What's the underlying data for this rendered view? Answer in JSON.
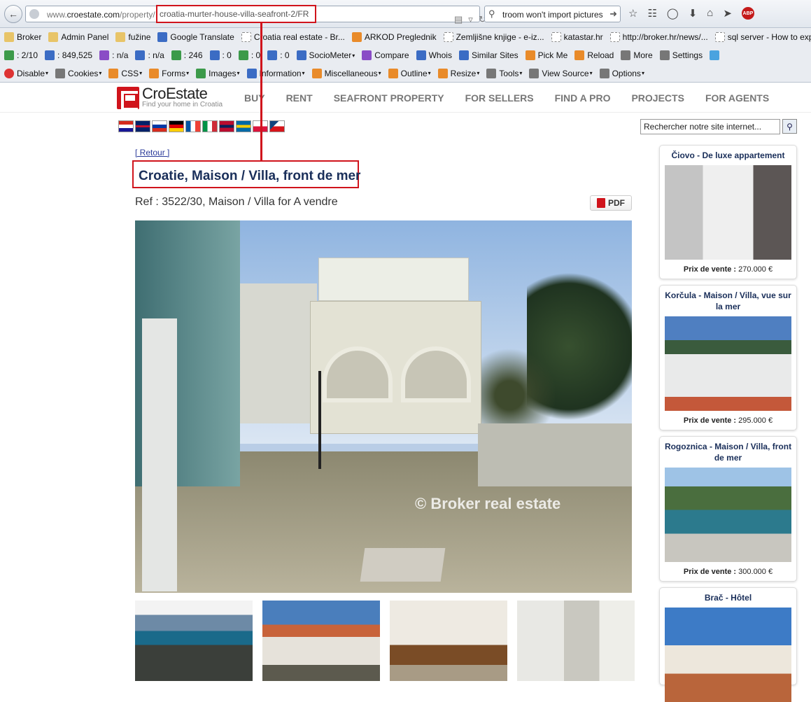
{
  "browser": {
    "url_prefix": "www.",
    "url_host": "croestate.com",
    "url_path": "/property/",
    "url_highlight": "croatia-murter-house-villa-seafront-2/FR",
    "search_text": "troom won't import pictures"
  },
  "bookmarks_row1": [
    {
      "label": "Broker",
      "icon": "folder-icon"
    },
    {
      "label": "Admin Panel",
      "icon": "folder-icon"
    },
    {
      "label": "fužine",
      "icon": "folder-icon"
    },
    {
      "label": "Google Translate",
      "icon": "translate-icon"
    },
    {
      "label": "Croatia real estate - Br...",
      "icon": "page-icon"
    },
    {
      "label": "ARKOD Preglednik",
      "icon": "gear-icon"
    },
    {
      "label": "Zemljišne knjige - e-iz...",
      "icon": "page-icon"
    },
    {
      "label": "katastar.hr",
      "icon": "page-icon"
    },
    {
      "label": "http://broker.hr/news/...",
      "icon": "page-icon"
    },
    {
      "label": "sql server - How to exp...",
      "icon": "page-icon"
    }
  ],
  "bookmarks_row2": [
    {
      "label": ": 2/10",
      "icon": "google-icon"
    },
    {
      "label": ": 849,525",
      "icon": "alexa-icon"
    },
    {
      "label": ": n/a",
      "icon": "stats-icon"
    },
    {
      "label": ": n/a",
      "icon": "alpha-icon"
    },
    {
      "label": ": 246",
      "icon": "google-icon"
    },
    {
      "label": ": 0",
      "icon": "bing-icon"
    },
    {
      "label": ": 0",
      "icon": "google-icon"
    },
    {
      "label": ": 0",
      "icon": "bing-icon"
    },
    {
      "label": "SocioMeter",
      "icon": "chart-icon",
      "caret": true
    },
    {
      "label": "Compare",
      "icon": "compare-icon"
    },
    {
      "label": "Whois",
      "icon": "help-icon"
    },
    {
      "label": "Similar Sites",
      "icon": "similar-icon"
    },
    {
      "label": "Pick Me",
      "icon": "pick-icon"
    },
    {
      "label": "Reload",
      "icon": "reload-icon"
    },
    {
      "label": "More",
      "icon": "more-icon"
    },
    {
      "label": "Settings",
      "icon": "settings-icon"
    },
    {
      "label": "",
      "icon": "twitter-icon"
    }
  ],
  "bookmarks_row3": [
    {
      "label": "Disable",
      "icon": "disable-icon",
      "caret": true
    },
    {
      "label": "Cookies",
      "icon": "cookie-icon",
      "caret": true
    },
    {
      "label": "CSS",
      "icon": "css-icon",
      "caret": true
    },
    {
      "label": "Forms",
      "icon": "forms-icon",
      "caret": true
    },
    {
      "label": "Images",
      "icon": "images-icon",
      "caret": true
    },
    {
      "label": "Information",
      "icon": "info-icon",
      "caret": true
    },
    {
      "label": "Miscellaneous",
      "icon": "misc-icon",
      "caret": true
    },
    {
      "label": "Outline",
      "icon": "outline-icon",
      "caret": true
    },
    {
      "label": "Resize",
      "icon": "resize-icon",
      "caret": true
    },
    {
      "label": "Tools",
      "icon": "tools-icon",
      "caret": true
    },
    {
      "label": "View Source",
      "icon": "source-icon",
      "caret": true
    },
    {
      "label": "Options",
      "icon": "options-icon",
      "caret": true
    }
  ],
  "site": {
    "logo_name": "CroEstate",
    "logo_tagline": "Find your home in Croatia",
    "nav": [
      "BUY",
      "RENT",
      "SEAFRONT PROPERTY",
      "FOR SELLERS",
      "FIND A PRO",
      "PROJECTS",
      "FOR AGENTS"
    ],
    "search_placeholder": "Rechercher notre site internet...",
    "flags": [
      "croatian-flag",
      "uk-flag",
      "russian-flag",
      "german-flag",
      "french-flag",
      "italian-flag",
      "norwegian-flag",
      "swedish-flag",
      "polish-flag",
      "czech-flag"
    ]
  },
  "property": {
    "back_link": "[ Retour ]",
    "title": "Croatie, Maison / Villa, front de mer",
    "ref": "Ref : 3522/30, Maison / Villa for A vendre",
    "pdf_label": "PDF",
    "watermark": "© Broker real estate"
  },
  "sidebar": [
    {
      "title": "Čiovo - De luxe appartement",
      "price_label": "Prix de vente :",
      "price": "270.000 €"
    },
    {
      "title": "Korčula - Maison / Villa, vue sur la mer",
      "price_label": "Prix de vente :",
      "price": "295.000 €"
    },
    {
      "title": "Rogoznica - Maison / Villa, front de mer",
      "price_label": "Prix de vente :",
      "price": "300.000 €"
    },
    {
      "title": "Brač - Hôtel",
      "price_label": "",
      "price": ""
    }
  ],
  "colors": {
    "accent": "#d0141c",
    "title_blue": "#1a2f5a"
  }
}
